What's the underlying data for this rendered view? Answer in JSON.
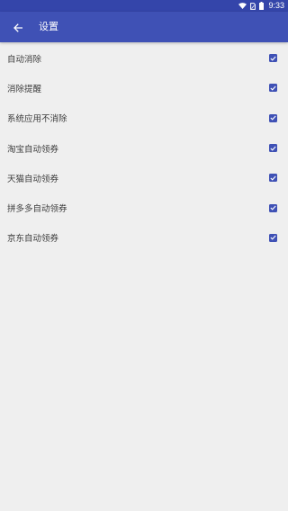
{
  "status_bar": {
    "time": "9:33",
    "icons": [
      "wifi-icon",
      "sim-card-icon",
      "battery-icon"
    ]
  },
  "app_bar": {
    "title": "设置",
    "back_icon": "arrow-back-icon"
  },
  "colors": {
    "status_bar": "#3445aa",
    "app_bar": "#3f51b5",
    "checkbox": "#3f51b5",
    "background": "#efefef",
    "label_text": "#3c3c3c"
  },
  "settings": {
    "items": [
      {
        "label": "自动消除",
        "checked": true
      },
      {
        "label": "消除提醒",
        "checked": true
      },
      {
        "label": "系统应用不消除",
        "checked": true
      },
      {
        "label": "淘宝自动领券",
        "checked": true
      },
      {
        "label": "天猫自动领券",
        "checked": true
      },
      {
        "label": "拼多多自动领券",
        "checked": true
      },
      {
        "label": "京东自动领券",
        "checked": true
      }
    ]
  }
}
